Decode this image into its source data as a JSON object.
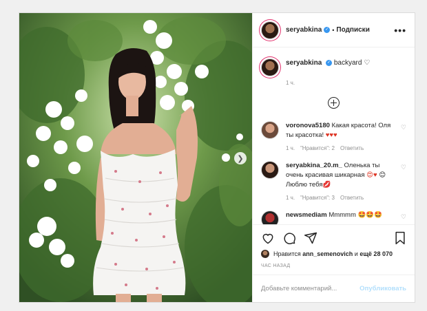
{
  "header": {
    "username": "seryabkina",
    "separator": "•",
    "follow_label": "Подписки",
    "more_label": "•••"
  },
  "caption": {
    "username": "seryabkina",
    "text": "backyard",
    "emoji": "♡",
    "time": "1 ч."
  },
  "comments": [
    {
      "username": "voronova5180",
      "text": "Какая красота! Оля ты красотка!",
      "emoji": "♥♥♥",
      "time": "1 ч.",
      "likes": "\"Нравится\": 2",
      "reply": "Ответить"
    },
    {
      "username": "seryabkina_20.m_",
      "text": "Оленька ты очень красивая шикарная",
      "emoji_mid": "😍♥",
      "text2": "Люблю тебя",
      "emoji_pre": "😊",
      "emoji_end": "💋",
      "time": "1 ч.",
      "likes": "\"Нравится\": 3",
      "reply": "Ответить"
    },
    {
      "username": "newsmediam",
      "text": "Mmmmm",
      "emoji": "🤩🤩🤩"
    }
  ],
  "likes": {
    "prefix": "Нравится",
    "user": "ann_semenovich",
    "connector": "и",
    "others": "ещё 28 070"
  },
  "time_ago": "ЧАС НАЗАД",
  "add_comment": {
    "placeholder": "Добавьте комментарий...",
    "publish_label": "Опубликовать"
  },
  "icons": {
    "heart": "heart-icon",
    "comment": "comment-icon",
    "share": "share-icon",
    "bookmark": "bookmark-icon",
    "next": "chevron-right-icon"
  },
  "colors": {
    "verified": "#3897f0",
    "publish_disabled": "#b2dffc",
    "red_heart": "#dd3322"
  }
}
